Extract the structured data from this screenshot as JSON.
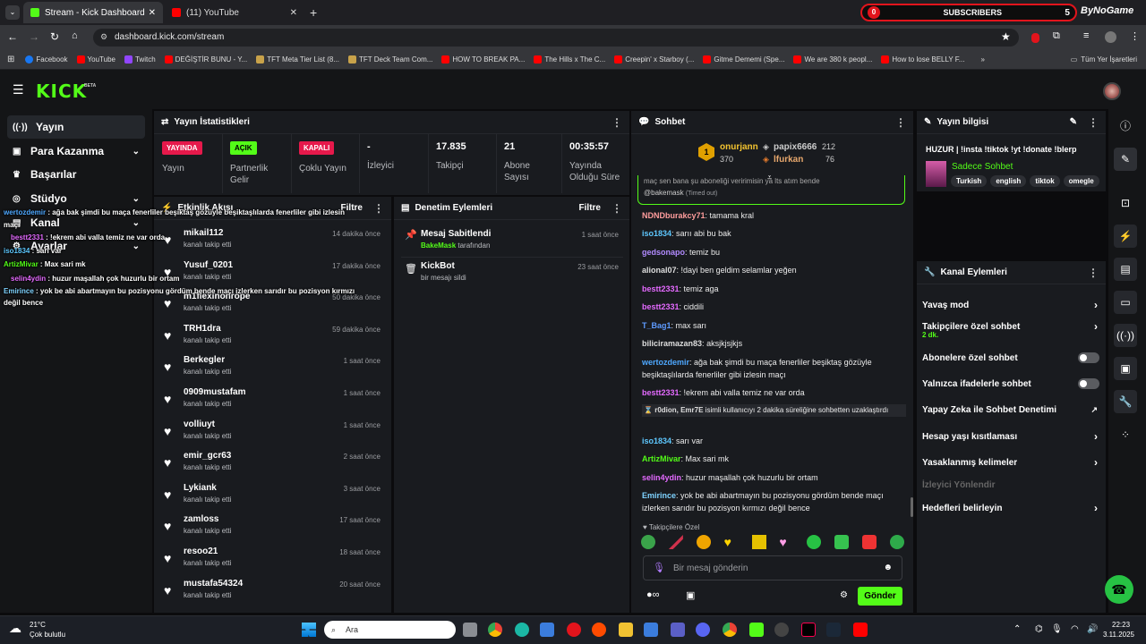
{
  "browser": {
    "tabs": [
      {
        "label": "Stream - Kick Dashboard"
      },
      {
        "label": "(11) YouTube"
      }
    ],
    "url": "dashboard.kick.com/stream",
    "bookmarks": [
      "Facebook",
      "YouTube",
      "Twitch",
      "DEĞİŞTİR BUNU - Y...",
      "TFT Meta Tier List (8...",
      "TFT Deck Team Com...",
      "HOW TO BREAK PA...",
      "The Hills x The C...",
      "Creepin' x Starboy (...",
      "Gitme Dememi (Spe...",
      "We are 380 k peopl...",
      "How to lose BELLY F..."
    ],
    "all_bookmarks": "Tüm Yer İşaretleri",
    "subscribers": {
      "label": "SUBSCRIBERS",
      "left": "0",
      "right": "5",
      "brand": "ByNoGame"
    }
  },
  "kick": {
    "logo": "KICK",
    "beta": "BETA"
  },
  "sidebar": {
    "items": [
      {
        "label": "Yayın"
      },
      {
        "label": "Para Kazanma"
      },
      {
        "label": "Başarılar"
      },
      {
        "label": "Stüdyo"
      },
      {
        "label": "Kanal"
      },
      {
        "label": "Ayarlar"
      }
    ]
  },
  "stats": {
    "title": "Yayın İstatistikleri",
    "cells": [
      {
        "badge": "YAYINDA",
        "label": "Yayın"
      },
      {
        "badge": "AÇIK",
        "label": "Partnerlik Gelir"
      },
      {
        "badge": "KAPALI",
        "label": "Çoklu Yayın"
      },
      {
        "value": "-",
        "label": "İzleyici"
      },
      {
        "value": "17.835",
        "label": "Takipçi"
      },
      {
        "value": "21",
        "label": "Abone Sayısı"
      },
      {
        "value": "00:35:57",
        "label": "Yayında Olduğu Süre"
      }
    ]
  },
  "activity": {
    "title": "Etkinlik Akışı",
    "filter": "Filtre",
    "items": [
      {
        "name": "mikail112",
        "sub": "kanalı takip etti",
        "time": "14 dakika önce"
      },
      {
        "name": "Yusuf_0201",
        "sub": "kanalı takip etti",
        "time": "17 dakika önce"
      },
      {
        "name": "m1flexinonrope",
        "sub": "kanalı takip etti",
        "time": "50 dakika önce"
      },
      {
        "name": "TRH1dra",
        "sub": "kanalı takip etti",
        "time": "59 dakika önce"
      },
      {
        "name": "Berkegler",
        "sub": "kanalı takip etti",
        "time": "1 saat önce"
      },
      {
        "name": "0909mustafam",
        "sub": "kanalı takip etti",
        "time": "1 saat önce"
      },
      {
        "name": "volliuyt",
        "sub": "kanalı takip etti",
        "time": "1 saat önce"
      },
      {
        "name": "emir_gcr63",
        "sub": "kanalı takip etti",
        "time": "2 saat önce"
      },
      {
        "name": "Lykiank",
        "sub": "kanalı takip etti",
        "time": "3 saat önce"
      },
      {
        "name": "zamloss",
        "sub": "kanalı takip etti",
        "time": "17 saat önce"
      },
      {
        "name": "resoo21",
        "sub": "kanalı takip etti",
        "time": "18 saat önce"
      },
      {
        "name": "mustafa54324",
        "sub": "kanalı takip etti",
        "time": "20 saat önce"
      }
    ]
  },
  "moderation": {
    "title": "Denetim Eylemleri",
    "filter": "Filtre",
    "items": [
      {
        "name": "Mesaj Sabitlendi",
        "sub_user": "BakeMask",
        "sub": "tarafından",
        "time": "1 saat önce"
      },
      {
        "name": "KickBot",
        "sub": "bir mesajı sildi",
        "time": "23 saat önce"
      }
    ]
  },
  "chat": {
    "title": "Sohbet",
    "leaders": [
      {
        "name": "onurjann",
        "count": "370"
      },
      {
        "name": "papix6666",
        "count": "212"
      },
      {
        "name": "lfurkan",
        "count": "76"
      }
    ],
    "pinned_top": "maç sen bana şu aboneliği veririmisin ya lts atım bende",
    "pinned_user": "@bakemask",
    "pinned_note": "(Timed out)",
    "messages": [
      {
        "user": "NDNDburakcy71",
        "color": "#ff9d9d",
        "text": "tamama kral"
      },
      {
        "user": "iso1834",
        "color": "#5ec8ff",
        "text": "sarıı abi bu bak"
      },
      {
        "user": "gedsonapo",
        "color": "#b28bff",
        "text": "temiz bu"
      },
      {
        "user": "alional07",
        "color": "#dedede",
        "text": "!dayi ben geldim selamlar yeğen"
      },
      {
        "user": "bestt2331",
        "color": "#e46aff",
        "text": "temiz aga"
      },
      {
        "user": "bestt2331",
        "color": "#e46aff",
        "text": "ciddili"
      },
      {
        "user": "T_Bag1",
        "color": "#5e9bff",
        "text": "max sarı"
      },
      {
        "user": "biliciramazan83",
        "color": "#dedede",
        "text": "aksjkjsjkjs"
      },
      {
        "user": "wertozdemir",
        "color": "#4ea8ff",
        "text": "ağa bak şimdi bu maça fenerliler beşiktaş gözüyle beşiktaşlılarda fenerliler gibi izlesin maçı"
      },
      {
        "user": "bestt2331",
        "color": "#e46aff",
        "text": "!ekrem abi valla temiz ne var orda"
      },
      {
        "user": "r0dion, Emr7E",
        "color": "#dedede",
        "text": "isimli kullanıcıyı 2 dakika süreliğine sohbetten uzaklaştırdı"
      },
      {
        "user": "iso1834",
        "color": "#5ec8ff",
        "text": "sarı var"
      },
      {
        "user": "ArtizMivar",
        "color": "#53fc18",
        "text": "Max sari mk"
      },
      {
        "user": "selin4ydin",
        "color": "#e46aff",
        "text": "huzur maşallah çok huzurlu bir ortam"
      },
      {
        "user": "Emirince",
        "color": "#7fd3ff",
        "text": "yok be abi abartmayın bu pozisyonu gördüm bende maçı izlerken sarıdır bu pozisyon kırmızı değil bence"
      }
    ],
    "emote_label": "Takipçilere Özel",
    "input_placeholder": "Bir mesaj gönderin",
    "send": "Gönder"
  },
  "info": {
    "title": "Yayın bilgisi",
    "stream_title": "HUZUR | !insta !tiktok !yt !donate !blerp",
    "category": "Sadece Sohbet",
    "tags": [
      "Turkish",
      "english",
      "tiktok",
      "omegle"
    ]
  },
  "channel": {
    "title": "Kanal Eylemleri",
    "items": [
      {
        "label": "Yavaş mod",
        "kind": "arrow"
      },
      {
        "label": "Takipçilere özel sohbet",
        "sub": "2 dk.",
        "kind": "arrow"
      },
      {
        "label": "Abonelere özel sohbet",
        "kind": "toggle"
      },
      {
        "label": "Yalnızca ifadelerle sohbet",
        "kind": "toggle"
      },
      {
        "label": "Yapay Zeka ile Sohbet Denetimi",
        "kind": "ext"
      },
      {
        "label": "Hesap yaşı kısıtlaması",
        "kind": "arrow"
      },
      {
        "label": "Yasaklanmış kelimeler",
        "kind": "arrow"
      },
      {
        "label": "İzleyici Yönlendir",
        "kind": "disabled"
      },
      {
        "label": "Hedefleri belirleyin",
        "kind": "arrow"
      }
    ]
  },
  "overlay": [
    {
      "user": "wertozdemir",
      "color": "#4ea8ff",
      "text": "ağa bak şimdi bu maça fenerliler beşiktaş gözüyle beşiktaşlılarda fenerliler gibi izlesin"
    },
    {
      "user": "",
      "color": "#fff",
      "text": "maçı"
    },
    {
      "user": "bestt2331",
      "color": "#e46aff",
      "text": "!ekrem abi valla temiz ne var orda"
    },
    {
      "user": "iso1834",
      "color": "#5ec8ff",
      "text": "sarı var"
    },
    {
      "user": "ArtizMivar",
      "color": "#53fc18",
      "text": "Max sari mk"
    },
    {
      "user": "selin4ydin",
      "color": "#e46aff",
      "text": "huzur maşallah çok huzurlu bir ortam"
    },
    {
      "user": "Emirince",
      "color": "#7fd3ff",
      "text": "yok be abi abartmayın bu pozisyonu gördüm bende maçı izlerken sarıdır bu pozisyon kırmızı"
    },
    {
      "user": "",
      "color": "#fff",
      "text": "değil bence"
    }
  ],
  "taskbar": {
    "weather_temp": "21°C",
    "weather_desc": "Çok bulutlu",
    "search": "Ara",
    "time": "22:23",
    "date": "3.11.2025"
  }
}
